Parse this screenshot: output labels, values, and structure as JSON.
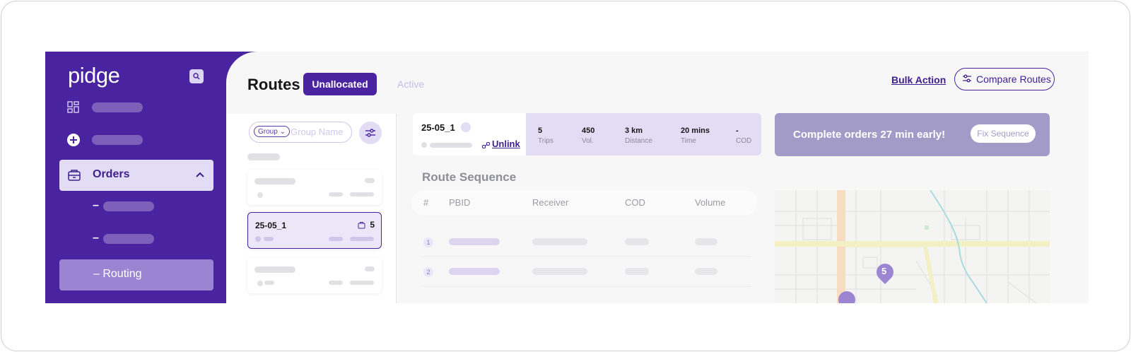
{
  "sidebar": {
    "logo": "pidge",
    "orders_label": "Orders",
    "routing_label": "Routing"
  },
  "header": {
    "title": "Routes",
    "tabs": [
      {
        "label": "Unallocated",
        "active": true
      },
      {
        "label": "Active",
        "active": false
      }
    ],
    "bulk_action": "Bulk Action",
    "compare_routes": "Compare Routes"
  },
  "list": {
    "group_chip": "Group",
    "search_placeholder": "Group Name",
    "selected_card": {
      "title": "25-05_1",
      "count": "5"
    }
  },
  "route": {
    "id": "25-05_1",
    "unlink": "Unlink",
    "stats": [
      {
        "value": "5",
        "label": "Trips"
      },
      {
        "value": "450",
        "label": "Vol."
      },
      {
        "value": "3 km",
        "label": "Distance"
      },
      {
        "value": "20 mins",
        "label": "Time"
      },
      {
        "value": "-",
        "label": "COD"
      }
    ]
  },
  "promo": {
    "text": "Complete orders 27 min early!",
    "button": "Fix Sequence"
  },
  "sequence": {
    "title": "Route Sequence",
    "columns": [
      "#",
      "PBID",
      "Receiver",
      "COD",
      "Volume"
    ],
    "row_numbers": [
      "1",
      "2"
    ]
  },
  "map": {
    "marker_label": "5"
  },
  "colors": {
    "brand": "#4a23a0",
    "brand_light": "#e3dcf5",
    "promo": "#a39bc7"
  }
}
